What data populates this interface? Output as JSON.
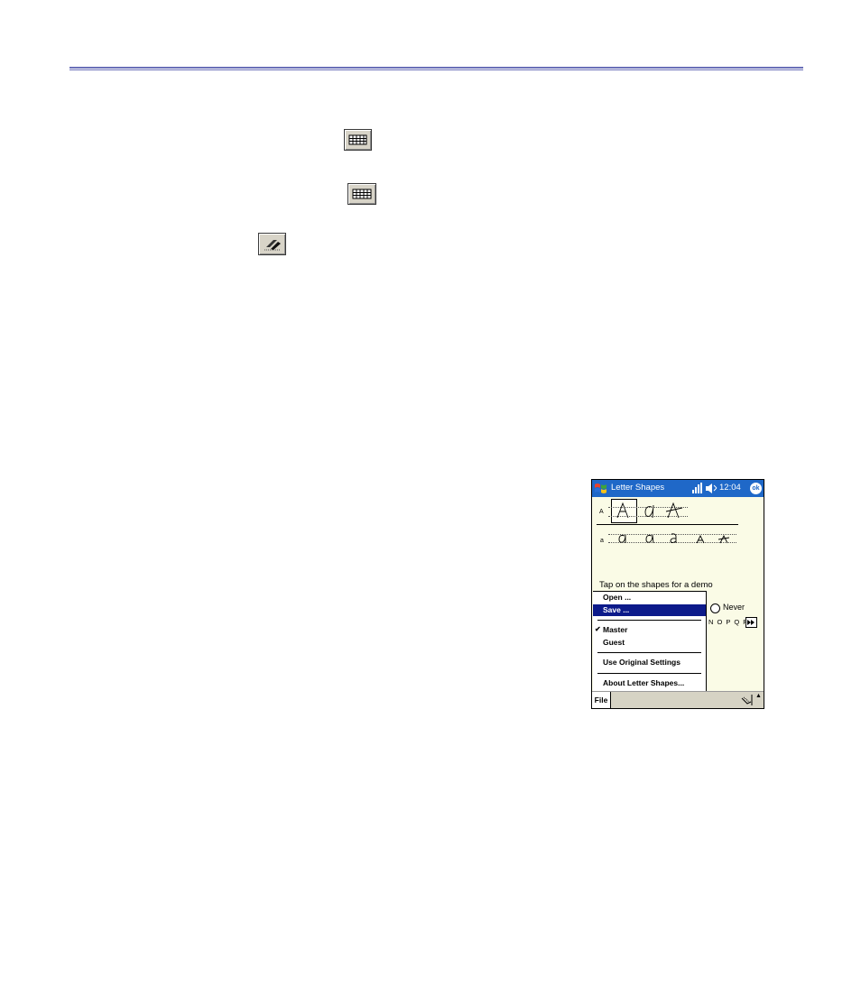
{
  "app": {
    "title": "Letter Shapes",
    "time": "12:04",
    "ok_label": "ok"
  },
  "rows": {
    "upper_label": "A",
    "lower_label": "a"
  },
  "demo_text": "Tap on the shapes for a demo",
  "option": {
    "never_label": "Never"
  },
  "letter_nav": {
    "letters": "N O P Q R"
  },
  "menu": {
    "items": [
      {
        "label": "Open ...",
        "highlighted": false,
        "checked": false
      },
      {
        "label": "Save ...",
        "highlighted": true,
        "checked": false
      },
      {
        "label": "Master",
        "highlighted": false,
        "checked": true
      },
      {
        "label": "Guest",
        "highlighted": false,
        "checked": false
      },
      {
        "label": "Use Original Settings",
        "highlighted": false,
        "checked": false
      },
      {
        "label": "About Letter Shapes...",
        "highlighted": false,
        "checked": false
      }
    ]
  },
  "command_bar": {
    "file_label": "File"
  },
  "colors": {
    "rule": "#6a6fb8",
    "titlebar": "#1f68c8",
    "menu_highlight": "#0c1a8a",
    "screen_bg": "#fafbe6"
  },
  "icons": [
    "keyboard-icon",
    "keyboard-icon",
    "transcriber-icon",
    "windows-flag-icon",
    "signal-icon",
    "speaker-icon",
    "input-panel-icon"
  ]
}
